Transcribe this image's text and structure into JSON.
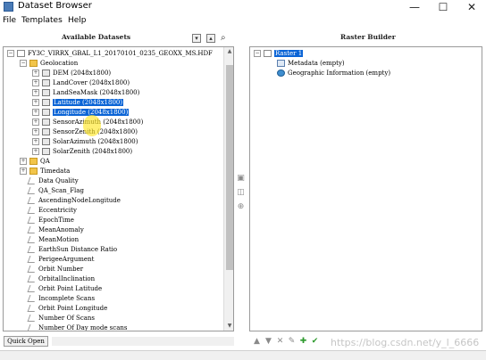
{
  "window": {
    "title": "Dataset Browser",
    "minimize": "—",
    "maximize": "☐",
    "close": "✕"
  },
  "menu": [
    "File",
    "Templates",
    "Help"
  ],
  "left_panel": {
    "title": "Available Datasets",
    "collapse_glyph": "▾",
    "expand_glyph": "▴",
    "search_glyph": "⌕",
    "root": "FY3C_VIRRX_GBAL_L1_20170101_0235_GEOXX_MS.HDF",
    "geolocation": "Geolocation",
    "geo_items": [
      "DEM (2048x1800)",
      "LandCover (2048x1800)",
      "LandSeaMask (2048x1800)",
      "Latitude (2048x1800)",
      "Longitude (2048x1800)",
      "SensorAzimuth (2048x1800)",
      "SensorZenith (2048x1800)",
      "SolarAzimuth (2048x1800)",
      "SolarZenith (2048x1800)"
    ],
    "groups": [
      "QA",
      "Timedata"
    ],
    "attributes": [
      "Data Quality",
      "QA_Scan_Flag",
      "AscendingNodeLongitude",
      "Eccentricity",
      "EpochTime",
      "MeanAnomaly",
      "MeanMotion",
      "EarthSun Distance Ratio",
      "PerigeeArgument",
      "Orbit Number",
      "OrbitalInclination",
      "Orbit Point Latitude",
      "Incomplete Scans",
      "Orbit Point Longitude",
      "Number Of Scans",
      "Number Of Day mode scans"
    ],
    "quick_open": "Quick Open"
  },
  "right_panel": {
    "title": "Raster Builder",
    "raster": "Raster 1",
    "children": [
      "Metadata (empty)",
      "Geographic Information (empty)"
    ]
  },
  "watermark": "https://blog.csdn.net/y_l_6666"
}
